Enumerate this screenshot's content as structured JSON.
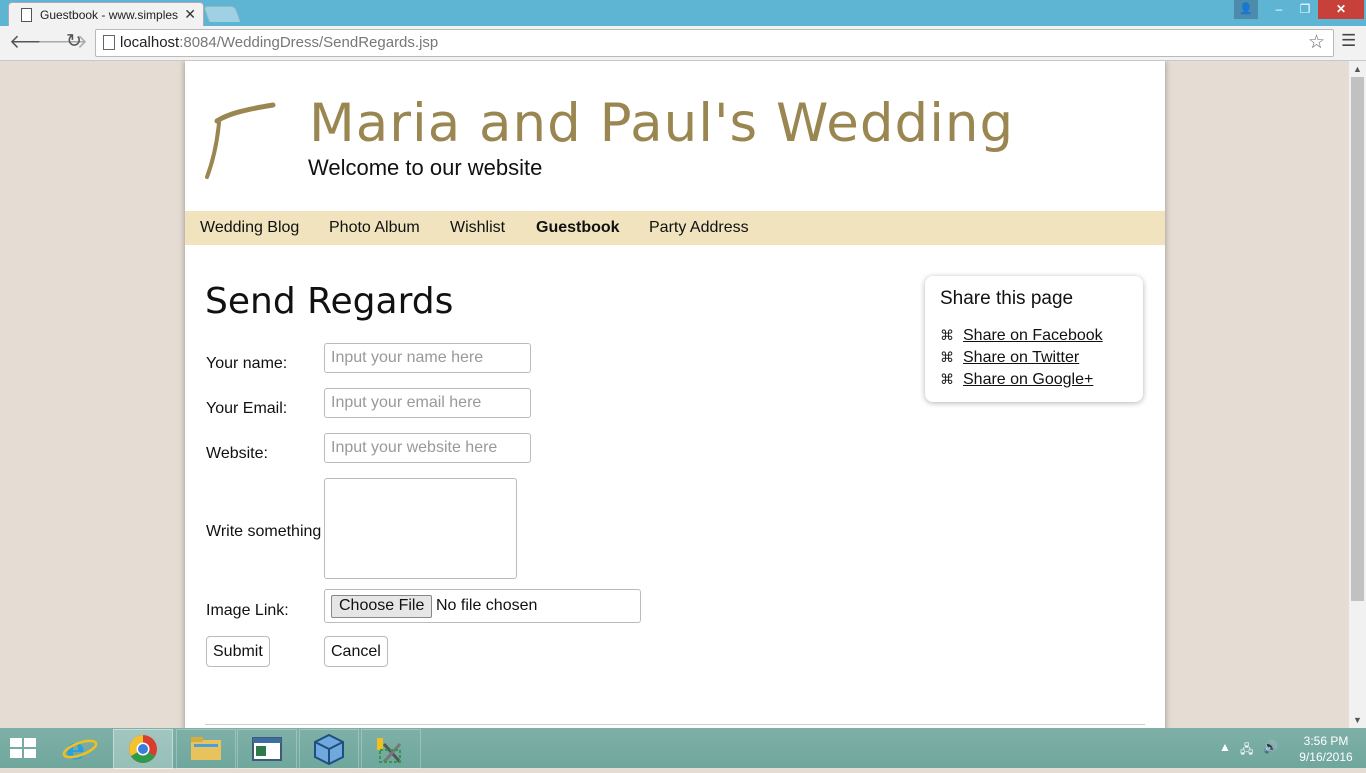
{
  "browser": {
    "tab_title": "Guestbook - www.simples",
    "tab_close": "✕",
    "url_host": "localhost",
    "url_rest": ":8084/WeddingDress/SendRegards.jsp",
    "window_controls": {
      "user": "👤",
      "min": "–",
      "max": "❐",
      "close": "✕"
    }
  },
  "site": {
    "title": "Maria and Paul's Wedding",
    "subtitle": "Welcome to our website",
    "accent_color": "#9a8650",
    "nav_bg_color": "#f0e3be"
  },
  "nav": {
    "items": [
      {
        "label": "Wedding Blog",
        "active": false
      },
      {
        "label": "Photo Album",
        "active": false
      },
      {
        "label": "Wishlist",
        "active": false
      },
      {
        "label": "Guestbook",
        "active": true
      },
      {
        "label": "Party Address",
        "active": false
      }
    ]
  },
  "form": {
    "heading": "Send Regards",
    "name_label": "Your name:",
    "name_placeholder": "Input your name here",
    "email_label": "Your Email:",
    "email_placeholder": "Input your email here",
    "website_label": "Website:",
    "website_placeholder": "Input your website here",
    "message_label": "Write something",
    "image_label": "Image Link:",
    "file_button": "Choose File",
    "file_status": "No file chosen",
    "submit": "Submit",
    "cancel": "Cancel"
  },
  "share": {
    "heading": "Share this page",
    "links": [
      {
        "icon": "facebook-icon",
        "label": "Share on Facebook"
      },
      {
        "icon": "twitter-icon",
        "label": "Share on Twitter"
      },
      {
        "icon": "google-plus-icon",
        "label": "Share on Google+"
      }
    ]
  },
  "taskbar": {
    "time": "3:56 PM",
    "date": "9/16/2016",
    "apps": [
      "internet-explorer-icon",
      "chrome-icon",
      "file-explorer-icon",
      "window-app-icon",
      "virtualbox-icon",
      "tools-app-icon"
    ]
  }
}
